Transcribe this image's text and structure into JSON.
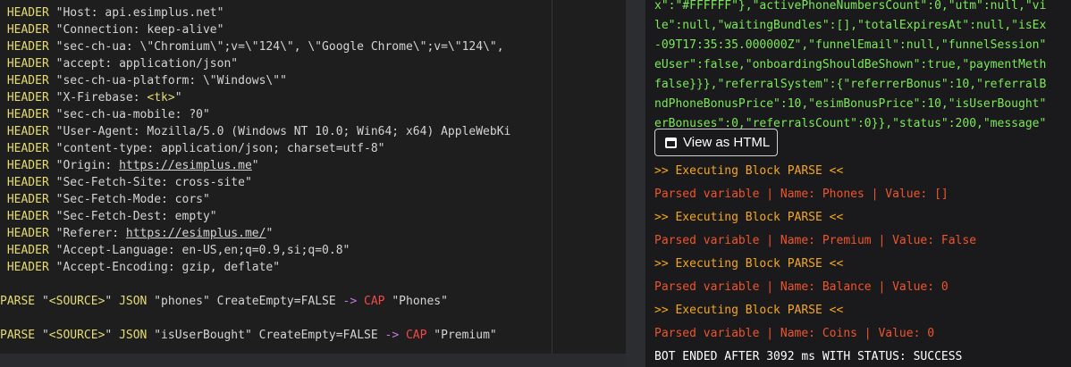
{
  "editor": {
    "headers": [
      "\"Host: api.esimplus.net\"",
      "\"Connection: keep-alive\"",
      "\"sec-ch-ua: \\\"Chromium\\\";v=\\\"124\\\", \\\"Google Chrome\\\";v=\\\"124\\\",",
      "\"accept: application/json\"",
      "\"sec-ch-ua-platform: \\\"Windows\\\"\"",
      "\"X-Firebase: ",
      "\"sec-ch-ua-mobile: ?0\"",
      "\"User-Agent: Mozilla/5.0 (Windows NT 10.0; Win64; x64) AppleWebKi",
      "\"content-type: application/json; charset=utf-8\"",
      "\"Origin: ",
      "\"Sec-Fetch-Site: cross-site\"",
      "\"Sec-Fetch-Mode: cors\"",
      "\"Sec-Fetch-Dest: empty\"",
      "\"Referer: ",
      "\"Accept-Language: en-US,en;q=0.9,si;q=0.8\"",
      "\"Accept-Encoding: gzip, deflate\""
    ],
    "header_keyword": "HEADER",
    "tk_token": "<tk>",
    "origin_url": "https://esimplus.me",
    "referer_url": "https://esimplus.me/",
    "quote": "\"",
    "parse_lines": [
      {
        "keyword": "PARSE",
        "source": "\"<SOURCE>\"",
        "json": "JSON",
        "path": "\"phones\" CreateEmpty=FALSE",
        "arrow": "->",
        "cap": "CAP",
        "var": "\"Phones\""
      },
      {
        "keyword": "PARSE",
        "source": "\"<SOURCE>\"",
        "json": "JSON",
        "path": "\"isUserBought\" CreateEmpty=FALSE",
        "arrow": "->",
        "cap": "CAP",
        "var": "\"Premium\""
      }
    ]
  },
  "log": {
    "json_lines": [
      "x\":\"#FFFFFF\"},\"activePhoneNumbersCount\":0,\"utm\":null,\"vi",
      "le\":null,\"waitingBundles\":[],\"totalExpiresAt\":null,\"isEx",
      "-09T17:35:35.000000Z\",\"funnelEmail\":null,\"funnelSession\"",
      "eUser\":false,\"onboardingShouldBeShown\":true,\"paymentMeth",
      "false}}},\"referralSystem\":{\"referrerBonus\":10,\"referralB",
      "ndPhoneBonusPrice\":10,\"esimBonusPrice\":10,\"isUserBought\"",
      "erBonuses\":0,\"referralsCount\":0}},\"status\":200,\"message\""
    ],
    "view_html_label": "View as HTML",
    "entries": [
      {
        "exec": ">> Executing Block PARSE <<",
        "parsed": "Parsed variable | Name: Phones | Value: []"
      },
      {
        "exec": ">> Executing Block PARSE <<",
        "parsed": "Parsed variable | Name: Premium | Value: False"
      },
      {
        "exec": ">> Executing Block PARSE <<",
        "parsed": "Parsed variable | Name: Balance | Value: 0"
      },
      {
        "exec": ">> Executing Block PARSE <<",
        "parsed": "Parsed variable | Name: Coins | Value: 0"
      }
    ],
    "end_status": "BOT ENDED AFTER 3092 ms WITH STATUS: SUCCESS"
  }
}
